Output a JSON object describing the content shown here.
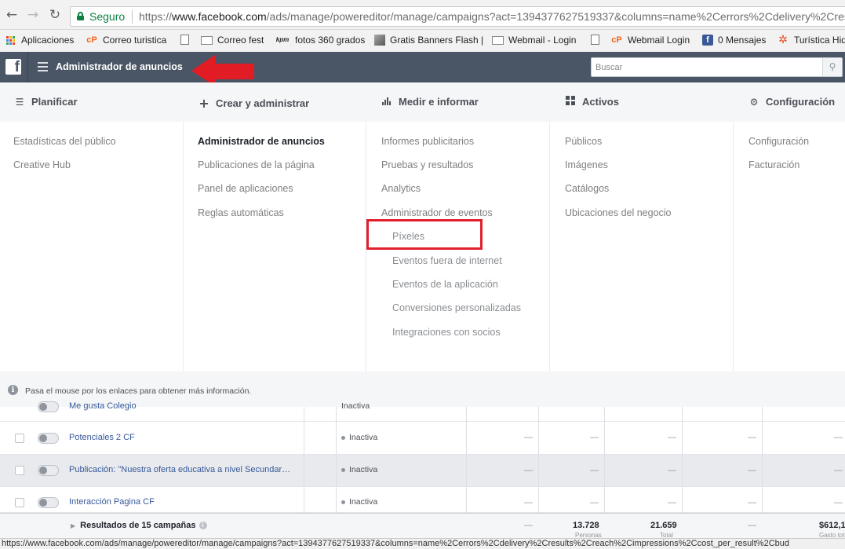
{
  "browser": {
    "secure_label": "Seguro",
    "url_scheme": "https://",
    "url_host": "www.facebook.com",
    "url_path": "/ads/manage/powereditor/manage/campaigns?act=1394377627519337&columns=name%2Cerrors%2Cdelivery%2Cres",
    "bookmarks": [
      {
        "label": "Aplicaciones",
        "icon": "apps-grid-icon"
      },
      {
        "label": "Correo turistica",
        "icon": "cpanel-icon"
      },
      {
        "label": "",
        "icon": "page-icon"
      },
      {
        "label": "Correo fest",
        "icon": "mail-icon"
      },
      {
        "label": "fotos 360 grados",
        "icon": "kpm-icon"
      },
      {
        "label": "Gratis Banners Flash |",
        "icon": "image-icon"
      },
      {
        "label": "Webmail - Login",
        "icon": "mail-icon"
      },
      {
        "label": "",
        "icon": "page-icon"
      },
      {
        "label": "Webmail Login",
        "icon": "cpanel-icon"
      },
      {
        "label": "0 Mensajes",
        "icon": "facebook-icon"
      },
      {
        "label": "Turística Hid",
        "icon": "joomla-icon"
      }
    ],
    "status_url": "https://www.facebook.com/ads/manage/powereditor/manage/campaigns?act=1394377627519337&columns=name%2Cerrors%2Cdelivery%2Cresults%2Creach%2Cimpressions%2Ccost_per_result%2Cbud"
  },
  "header": {
    "title": "Administrador de anuncios",
    "search_placeholder": "Buscar"
  },
  "menu": {
    "columns": [
      {
        "heading": "Planificar",
        "icon": "list-icon",
        "items": [
          "Estadísticas del público",
          "Creative Hub"
        ]
      },
      {
        "heading": "Crear y administrar",
        "icon": "plus-icon",
        "items": [
          "Administrador de anuncios",
          "Publicaciones de la página",
          "Panel de aplicaciones",
          "Reglas automáticas"
        ]
      },
      {
        "heading": "Medir e informar",
        "icon": "bar-chart-icon",
        "items": [
          "Informes publicitarios",
          "Pruebas y resultados",
          "Analytics",
          "Administrador de eventos"
        ],
        "subitems": [
          "Píxeles",
          "Eventos fuera de internet",
          "Eventos de la aplicación",
          "Conversiones personalizadas",
          "Integraciones con socios"
        ]
      },
      {
        "heading": "Activos",
        "icon": "grid-icon",
        "items": [
          "Públicos",
          "Imágenes",
          "Catálogos",
          "Ubicaciones del negocio"
        ]
      },
      {
        "heading": "Configuración",
        "icon": "gear-icon",
        "items": [
          "Configuración",
          "Facturación"
        ]
      }
    ],
    "footer_text": "Pasa el mouse por los enlaces para obtener más información."
  },
  "table": {
    "rows": [
      {
        "name": "Me gusta Colegio",
        "status": "Inactiva"
      },
      {
        "name": "Potenciales 2 CF",
        "status": "Inactiva"
      },
      {
        "name": "Publicación: \"Nuestra oferta educativa a nivel Secundar…",
        "status": "Inactiva"
      },
      {
        "name": "Interacción Pagina CF",
        "status": "Inactiva"
      }
    ],
    "dash": "—",
    "totals": {
      "label": "Resultados de 15 campañas",
      "values": [
        "13.728",
        "21.659",
        "$612,1"
      ],
      "sublabels": [
        "Personas",
        "Total",
        "Gasto tot"
      ]
    }
  }
}
